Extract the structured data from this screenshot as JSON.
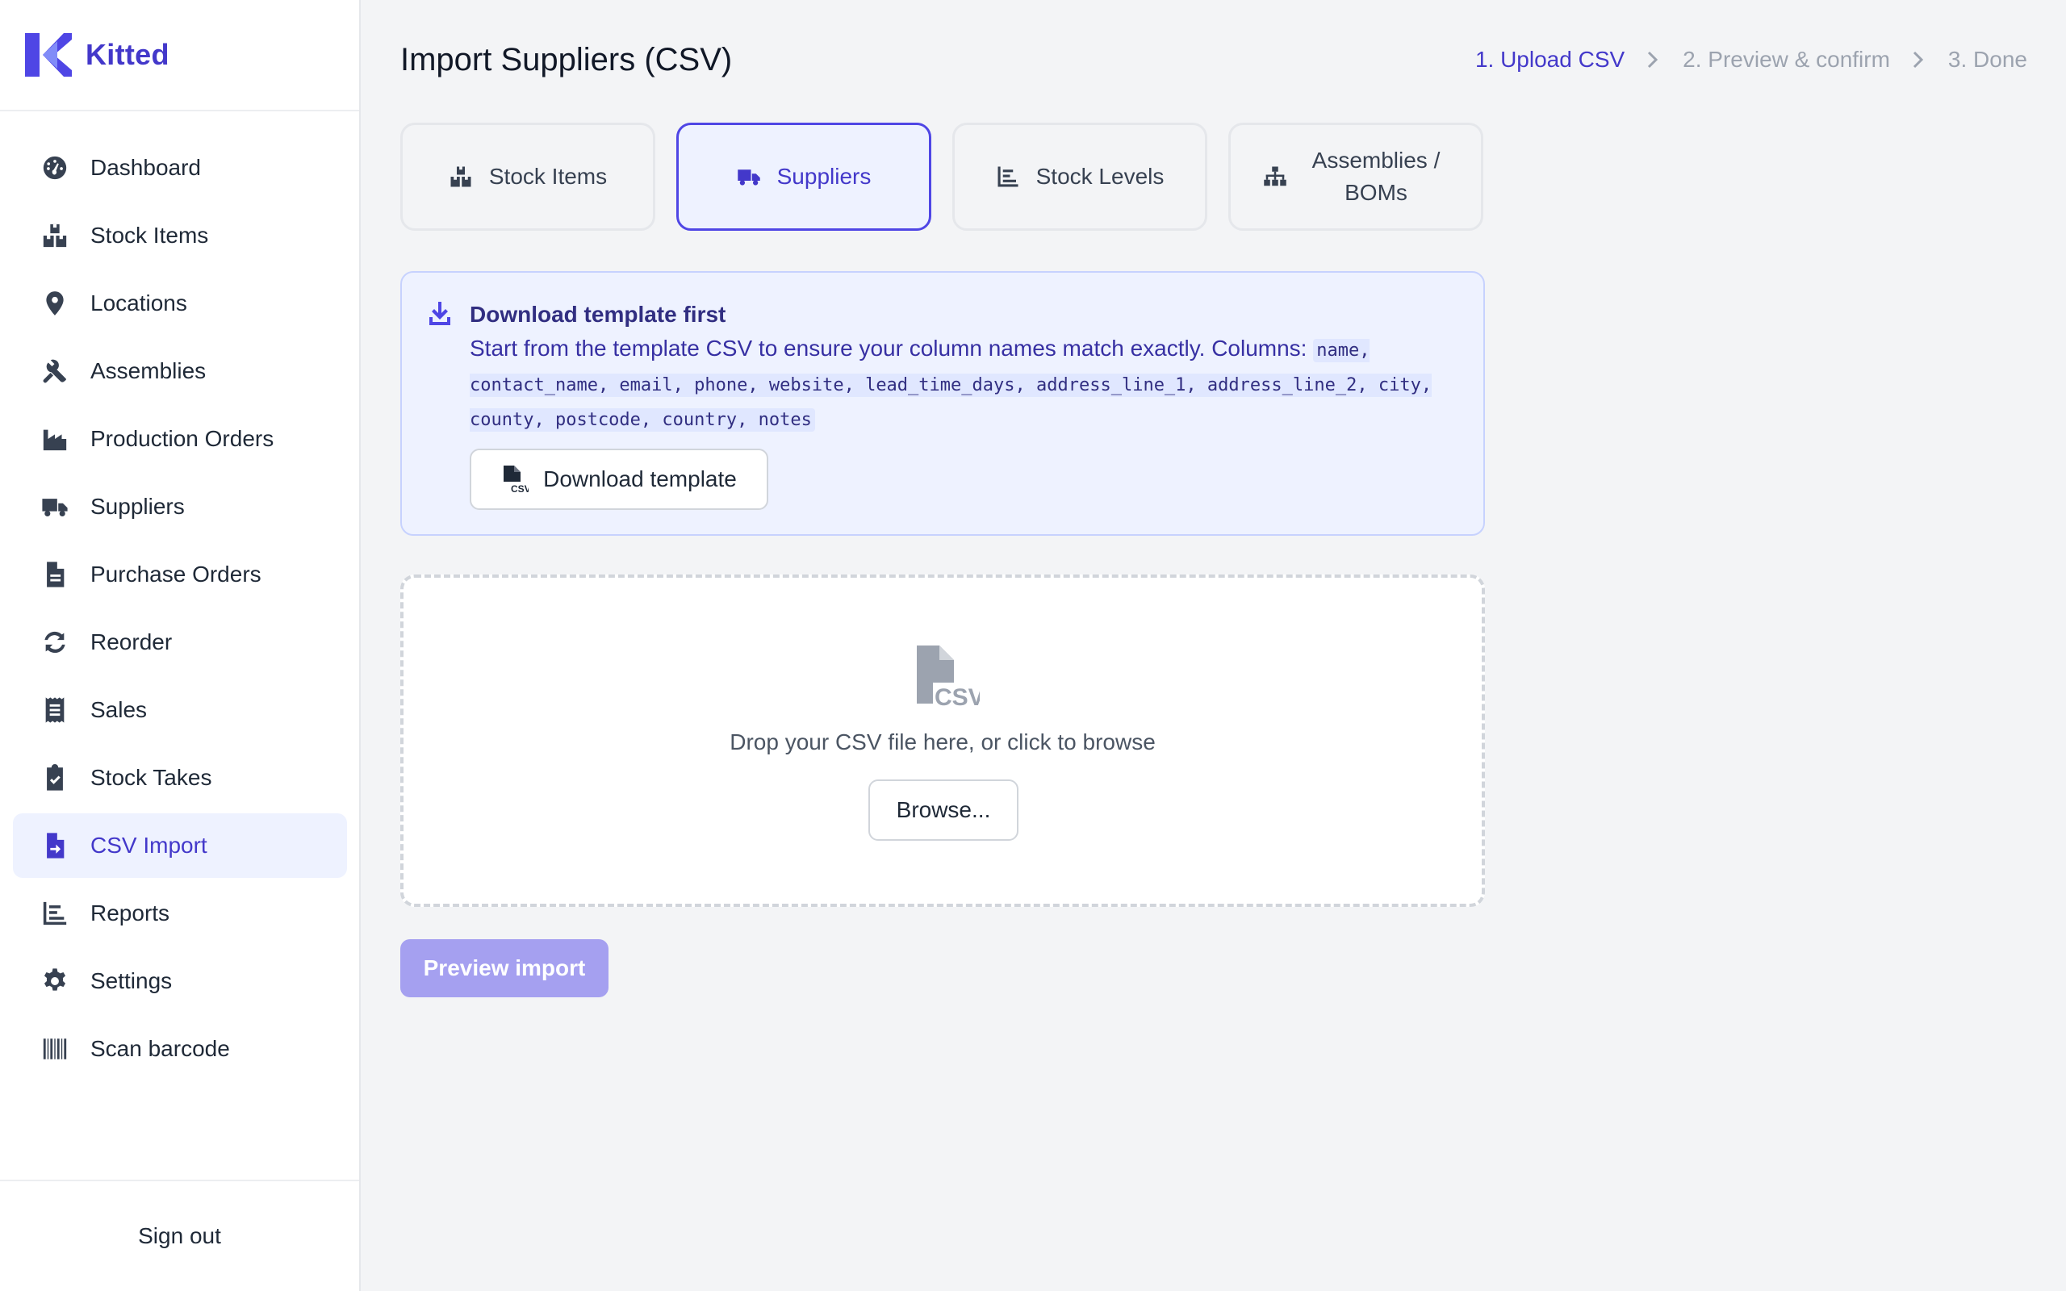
{
  "brand": {
    "name": "Kitted"
  },
  "sidebar": {
    "items": [
      {
        "label": "Dashboard",
        "icon": "dashboard-gauge-icon"
      },
      {
        "label": "Stock Items",
        "icon": "boxes-icon"
      },
      {
        "label": "Locations",
        "icon": "map-pin-icon"
      },
      {
        "label": "Assemblies",
        "icon": "tools-icon"
      },
      {
        "label": "Production Orders",
        "icon": "factory-icon"
      },
      {
        "label": "Suppliers",
        "icon": "truck-icon"
      },
      {
        "label": "Purchase Orders",
        "icon": "document-icon"
      },
      {
        "label": "Reorder",
        "icon": "refresh-icon"
      },
      {
        "label": "Sales",
        "icon": "receipt-icon"
      },
      {
        "label": "Stock Takes",
        "icon": "clipboard-check-icon"
      },
      {
        "label": "CSV Import",
        "icon": "file-import-icon",
        "active": true
      },
      {
        "label": "Reports",
        "icon": "bar-chart-icon"
      },
      {
        "label": "Settings",
        "icon": "gear-icon"
      },
      {
        "label": "Scan barcode",
        "icon": "barcode-icon"
      }
    ],
    "sign_out": "Sign out"
  },
  "header": {
    "title": "Import Suppliers (CSV)",
    "steps": [
      "1. Upload CSV",
      "2. Preview & confirm",
      "3. Done"
    ],
    "current_step": 0
  },
  "tabs": [
    {
      "label": "Stock Items",
      "icon": "boxes-icon"
    },
    {
      "label": "Suppliers",
      "icon": "truck-icon",
      "active": true
    },
    {
      "label": "Stock Levels",
      "icon": "bar-chart-icon"
    },
    {
      "label": "Assemblies / BOMs",
      "icon": "sitemap-icon"
    }
  ],
  "template_notice": {
    "title": "Download template first",
    "text": "Start from the template CSV to ensure your column names match exactly. Columns:",
    "columns": "name, contact_name, email, phone, website, lead_time_days, address_line_1, address_line_2, city, county, postcode, country, notes",
    "button_label": "Download template"
  },
  "dropzone": {
    "text": "Drop your CSV file here, or click to browse",
    "browse_label": "Browse..."
  },
  "actions": {
    "preview_label": "Preview import"
  },
  "colors": {
    "accent": "#4338ca",
    "accent_light": "#eef2ff",
    "disabled_button": "#a5a0f0",
    "background": "#f3f4f6"
  }
}
